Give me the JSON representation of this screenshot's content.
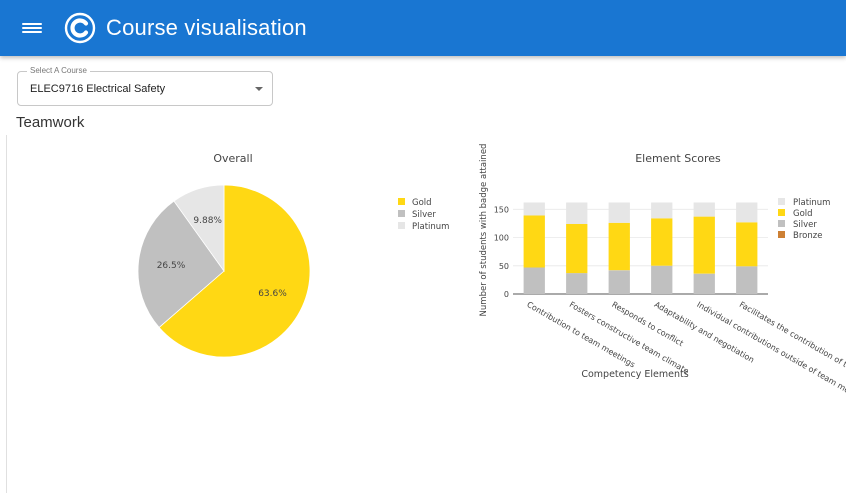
{
  "app": {
    "title": "Course visualisation"
  },
  "course_select": {
    "label": "Select A Course",
    "value": "ELEC9716 Electrical Safety"
  },
  "section": {
    "title": "Teamwork"
  },
  "colors": {
    "gold": "#ffd814",
    "silver": "#c0c0c0",
    "platinum": "#e6e6e6",
    "bronze": "#cd8034",
    "primary": "#1976d2"
  },
  "chart_data": [
    {
      "type": "pie",
      "title": "Overall",
      "slices": [
        {
          "label": "Gold",
          "value": 63.6,
          "text": "63.6%",
          "color": "#ffd814"
        },
        {
          "label": "Silver",
          "value": 26.5,
          "text": "26.5%",
          "color": "#c0c0c0"
        },
        {
          "label": "Platinum",
          "value": 9.88,
          "text": "9.88%",
          "color": "#e6e6e6"
        }
      ],
      "legend": [
        "Gold",
        "Silver",
        "Platinum"
      ],
      "legend_position": "right"
    },
    {
      "type": "bar",
      "stacked": true,
      "title": "Element Scores",
      "xlabel": "Competency Elements",
      "ylabel": "Number of students with badge attained",
      "categories": [
        "Contribution to team meetings",
        "Fosters constructive team climate",
        "Responds to conflict",
        "Adaptability and negotiation",
        "Individual contributions outside of team meetings",
        "Facilitates the contribution of team members"
      ],
      "series": [
        {
          "name": "Bronze",
          "color": "#cd8034",
          "values": [
            0,
            0,
            0,
            0,
            0,
            0
          ]
        },
        {
          "name": "Silver",
          "color": "#c0c0c0",
          "values": [
            47,
            37,
            42,
            50,
            36,
            49
          ]
        },
        {
          "name": "Gold",
          "color": "#ffd814",
          "values": [
            92,
            87,
            84,
            84,
            101,
            78
          ]
        },
        {
          "name": "Platinum",
          "color": "#e6e6e6",
          "values": [
            23,
            38,
            36,
            28,
            25,
            35
          ]
        }
      ],
      "legend": [
        "Platinum",
        "Gold",
        "Silver",
        "Bronze"
      ],
      "legend_position": "right",
      "yticks": [
        0,
        50,
        100,
        150
      ],
      "ylim": [
        0,
        170
      ],
      "grid": true
    }
  ]
}
